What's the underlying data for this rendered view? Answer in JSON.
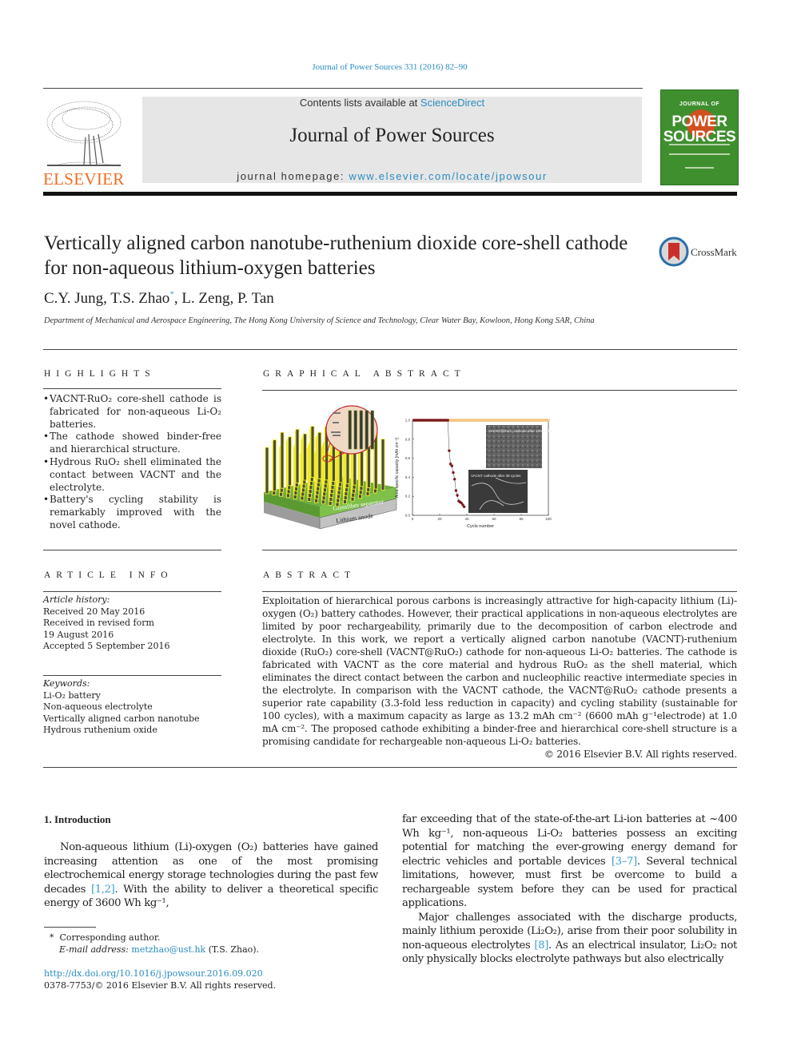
{
  "header": {
    "journal_ref": "Journal of Power Sources 331 (2016) 82–90",
    "publisher_logo_text": "ELSEVIER",
    "contents_prefix": "Contents lists available at ",
    "contents_link": "ScienceDirect",
    "journal_title": "Journal of Power Sources",
    "homepage_prefix": "journal homepage: ",
    "homepage_link": "www.elsevier.com/locate/jpowsour",
    "cover_top": "JOURNAL OF",
    "cover_title_1": "POWER",
    "cover_title_2": "SOURCES",
    "crossmark_label": "CrossMark"
  },
  "article": {
    "title": "Vertically aligned carbon nanotube-ruthenium dioxide core-shell cathode for non-aqueous lithium-oxygen batteries",
    "authors_before": "C.Y. Jung, T.S. Zhao",
    "authors_mark": "*",
    "authors_after": ", L. Zeng, P. Tan",
    "affiliation": "Department of Mechanical and Aerospace Engineering, The Hong Kong University of Science and Technology, Clear Water Bay, Kowloon, Hong Kong SAR, China"
  },
  "highlights": {
    "heading": "HIGHLIGHTS",
    "items": [
      "VACNT-RuO₂ core-shell cathode is fabricated for non-aqueous Li-O₂ batteries.",
      "The cathode showed binder-free and hierarchical structure.",
      "Hydrous RuO₂ shell eliminated the contact between VACNT and the electrolyte.",
      "Battery's cycling stability is remarkably improved with the novel cathode."
    ]
  },
  "graphical_abstract": {
    "heading": "GRAPHICAL ABSTRACT",
    "diagram_labels": {
      "separator": "Glassfiber separator",
      "anode": "Lithium anode"
    },
    "inset_labels": {
      "top": "VACNT@RuO₂ cathode after 100 cycles",
      "bottom": "VACNT cathode after 38 cycles"
    }
  },
  "chart_data": {
    "type": "scatter",
    "title": "",
    "xlabel": "Cycle number",
    "ylabel": "Area specific capacity [mAh cm⁻²]",
    "xlim": [
      0,
      100
    ],
    "ylim": [
      0.0,
      1.0
    ],
    "xticks": [
      "0",
      "20",
      "40",
      "60",
      "80",
      "100"
    ],
    "yticks": [
      "0.0",
      "0.2",
      "0.4",
      "0.6",
      "0.8",
      "1.0"
    ],
    "grid": false,
    "series": [
      {
        "name": "VACNT@RuO₂",
        "color": "#e8a23c",
        "x": [
          1,
          2,
          3,
          4,
          5,
          6,
          7,
          8,
          9,
          10,
          11,
          12,
          13,
          14,
          15,
          16,
          17,
          18,
          19,
          20,
          21,
          22,
          23,
          24,
          25,
          26,
          27,
          28,
          29,
          30,
          31,
          32,
          33,
          34,
          35,
          36,
          37,
          38,
          39,
          40,
          41,
          42,
          43,
          44,
          45,
          46,
          47,
          48,
          49,
          50,
          51,
          52,
          53,
          54,
          55,
          56,
          57,
          58,
          59,
          60,
          61,
          62,
          63,
          64,
          65,
          66,
          67,
          68,
          69,
          70,
          71,
          72,
          73,
          74,
          75,
          76,
          77,
          78,
          79,
          80,
          81,
          82,
          83,
          84,
          85,
          86,
          87,
          88,
          89,
          90,
          91,
          92,
          93,
          94,
          95,
          96,
          97,
          98,
          99,
          100
        ],
        "y_constant": 1.0
      },
      {
        "name": "VACNT",
        "color": "#7a1a1a",
        "x": [
          1,
          2,
          3,
          4,
          5,
          6,
          7,
          8,
          9,
          10,
          11,
          12,
          13,
          14,
          15,
          16,
          17,
          18,
          19,
          20,
          21,
          22,
          23,
          24,
          25,
          26,
          27,
          28,
          29,
          30,
          31,
          32,
          33,
          34,
          35,
          36,
          37,
          38
        ],
        "y": [
          1.0,
          1.0,
          1.0,
          1.0,
          1.0,
          1.0,
          1.0,
          1.0,
          1.0,
          1.0,
          1.0,
          1.0,
          1.0,
          1.0,
          1.0,
          1.0,
          1.0,
          1.0,
          1.0,
          1.0,
          1.0,
          1.0,
          1.0,
          1.0,
          1.0,
          1.0,
          0.68,
          0.54,
          0.52,
          0.45,
          0.38,
          0.26,
          0.21,
          0.15,
          0.14,
          0.13,
          0.11,
          0.09
        ]
      }
    ]
  },
  "article_info": {
    "heading": "ARTICLE INFO",
    "history_label": "Article history:",
    "history": [
      "Received 20 May 2016",
      "Received in revised form",
      "19 August 2016",
      "Accepted 5 September 2016"
    ],
    "keywords_label": "Keywords:",
    "keywords": [
      "Li-O₂ battery",
      "Non-aqueous electrolyte",
      "Vertically aligned carbon nanotube",
      "Hydrous ruthenium oxide"
    ]
  },
  "abstract": {
    "heading": "ABSTRACT",
    "text": "Exploitation of hierarchical porous carbons is increasingly attractive for high-capacity lithium (Li)-oxygen (O₂) battery cathodes. However, their practical applications in non-aqueous electrolytes are limited by poor rechargeability, primarily due to the decomposition of carbon electrode and electrolyte. In this work, we report a vertically aligned carbon nanotube (VACNT)-ruthenium dioxide (RuO₂) core-shell (VACNT@RuO₂) cathode for non-aqueous Li-O₂ batteries. The cathode is fabricated with VACNT as the core material and hydrous RuO₂ as the shell material, which eliminates the direct contact between the carbon and nucleophilic reactive intermediate species in the electrolyte. In comparison with the VACNT cathode, the VACNT@RuO₂ cathode presents a superior rate capability (3.3-fold less reduction in capacity) and cycling stability (sustainable for 100 cycles), with a maximum capacity as large as 13.2 mAh cm⁻² (6600 mAh g⁻¹electrode) at 1.0 mA cm⁻². The proposed cathode exhibiting a binder-free and hierarchical core-shell structure is a promising candidate for rechargeable non-aqueous Li-O₂ batteries.",
    "copyright": "© 2016 Elsevier B.V. All rights reserved."
  },
  "body": {
    "section_heading": "1.  Introduction",
    "para1_a": "Non-aqueous lithium (Li)-oxygen (O₂) batteries have gained increasing attention as one of the most promising electrochemical energy storage technologies during the past few decades ",
    "para1_cite1": "[1,2]",
    "para1_b": ". With the ability to deliver a theoretical specific energy of 3600 Wh kg⁻¹,",
    "para1_c": "far exceeding that of the state-of-the-art Li-ion batteries at ~400 Wh kg⁻¹, non-aqueous Li-O₂ batteries possess an exciting potential for matching the ever-growing energy demand for electric vehicles and portable devices ",
    "para1_cite2": "[3–7]",
    "para1_d": ". Several technical limitations, however, must first be overcome to build a rechargeable system before they can be used for practical applications.",
    "para2_a": "Major challenges associated with the discharge products, mainly lithium peroxide (Li₂O₂), arise from their poor solubility in non-aqueous electrolytes ",
    "para2_cite": "[8]",
    "para2_b": ". As an electrical insulator, Li₂O₂ not only physically blocks electrolyte pathways but also electrically"
  },
  "footnotes": {
    "mark": "*",
    "corresponding": "Corresponding author.",
    "email_label": "E-mail address:",
    "email": "metzhao@ust.hk",
    "email_suffix": " (T.S. Zhao).",
    "doi": "http://dx.doi.org/10.1016/j.jpowsour.2016.09.020",
    "issn_line": "0378-7753/© 2016 Elsevier B.V. All rights reserved."
  }
}
